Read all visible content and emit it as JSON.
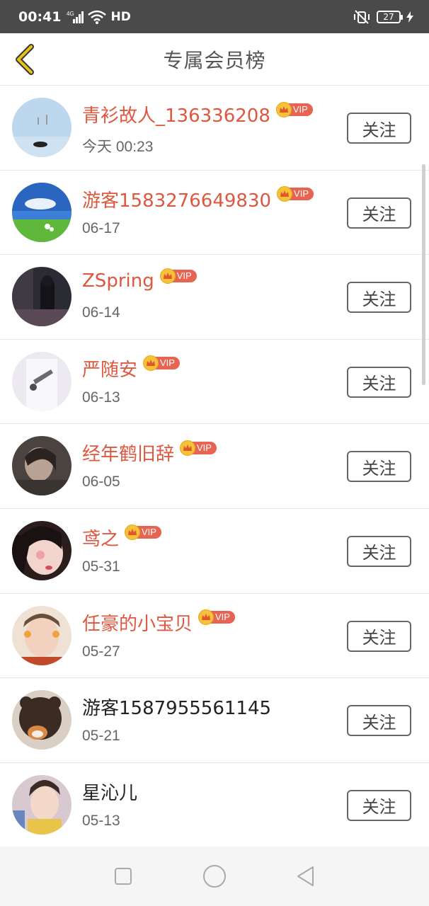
{
  "status_bar": {
    "time": "00:41",
    "network": "4G",
    "hd": "HD",
    "battery": "27"
  },
  "header": {
    "title": "专属会员榜"
  },
  "vip_label": "VIP",
  "follow_label": "关注",
  "members": [
    {
      "name": "青衫故人_136336208",
      "date": "今天 00:23",
      "vip": true
    },
    {
      "name": "游客1583276649830",
      "date": "06-17",
      "vip": true
    },
    {
      "name": "ZSpring",
      "date": "06-14",
      "vip": true
    },
    {
      "name": "严随安",
      "date": "06-13",
      "vip": true
    },
    {
      "name": "经年鹤旧辞",
      "date": "06-05",
      "vip": true
    },
    {
      "name": "鸢之",
      "date": "05-31",
      "vip": true
    },
    {
      "name": "任豪的小宝贝",
      "date": "05-27",
      "vip": true
    },
    {
      "name": "游客1587955561145",
      "date": "05-21",
      "vip": false
    },
    {
      "name": "星沁儿",
      "date": "05-13",
      "vip": false
    }
  ],
  "colors": {
    "vip_name": "#e0573f",
    "plain_name": "#222222",
    "header_bg": "#4a4a4a",
    "back_arrow": "#e7c11c"
  }
}
